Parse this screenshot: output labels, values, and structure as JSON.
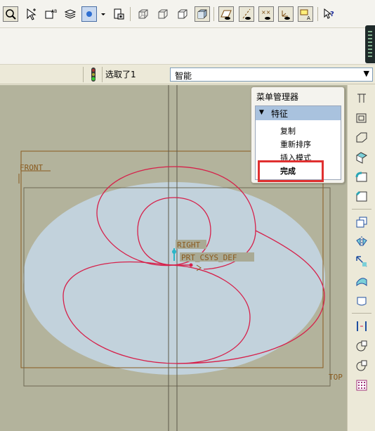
{
  "toolbar": {
    "icons": [
      "zoom-window-icon",
      "select-pointer-icon",
      "datum-text-icon",
      "layers-icon",
      "spin-center-icon",
      "dropdown-arrow-icon",
      "saved-views-icon",
      "wireframe-icon",
      "hidden-line-icon",
      "no-hidden-icon",
      "shading-icon",
      "datum-plane-display-icon",
      "datum-axis-display-icon",
      "point-display-icon",
      "csys-display-icon",
      "annotation-display-icon",
      "context-help-icon"
    ]
  },
  "status": {
    "selection_text": "选取了1",
    "filter_value": "智能"
  },
  "graphics": {
    "labels": {
      "front": "FRONT",
      "right": "RIGHT",
      "csys": "PRT_CSYS_DEF",
      "top": "TOP"
    }
  },
  "menu_manager": {
    "title": "菜单管理器",
    "section": "特征",
    "items": [
      "复制",
      "重新排序",
      "插入模式",
      "完成"
    ]
  },
  "colors": {
    "graphics_bg": "#b3b39c",
    "surface": "#c2d2dc",
    "curve": "#d6204a",
    "datum": "#8a5a1e",
    "highlight": "#e03030",
    "menu_header": "#a9c2de"
  }
}
